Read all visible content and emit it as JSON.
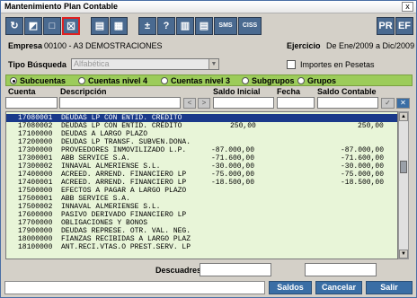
{
  "window": {
    "title": "Mantenimiento Plan Contable",
    "close": "x"
  },
  "toolbar": {
    "sms": "SMS",
    "ciss": "CISS",
    "pr": "PR",
    "ef": "EF"
  },
  "header": {
    "empresa_label": "Empresa",
    "empresa_value": "00100 - A3 DEMOSTRACIONES",
    "ejercicio_label": "Ejercicio",
    "ejercicio_value": "De Ene/2009 a Dic/2009",
    "tipo_label": "Tipo Búsqueda",
    "tipo_value": "Alfabética",
    "importes_label": "Importes en Pesetas",
    "importes_checked": false
  },
  "radios": [
    {
      "label": "Subcuentas",
      "on": true
    },
    {
      "label": "Cuentas nivel 4",
      "on": false
    },
    {
      "label": "Cuentas nivel 3",
      "on": false
    },
    {
      "label": "Subgrupos",
      "on": false
    },
    {
      "label": "Grupos",
      "on": false
    }
  ],
  "columns": {
    "cuenta": "Cuenta",
    "descripcion": "Descripción",
    "saldo_inicial": "Saldo Inicial",
    "fecha": "Fecha",
    "saldo_contable": "Saldo Contable"
  },
  "rows": [
    {
      "cuenta": "17080001",
      "desc": "DEUDAS LP CON ENTID. CRÉDITO",
      "si": "",
      "sc": "",
      "sel": true
    },
    {
      "cuenta": "17080002",
      "desc": "DEUDAS LP CON ENTID. CRÉDITO",
      "si": "250,00",
      "sc": "250,00"
    },
    {
      "cuenta": "17100000",
      "desc": "DEUDAS A LARGO PLAZO",
      "si": "",
      "sc": ""
    },
    {
      "cuenta": "17200000",
      "desc": "DEUDAS LP TRANSF. SUBVEN.DONA.",
      "si": "",
      "sc": ""
    },
    {
      "cuenta": "17300000",
      "desc": "PROVEEDORES INMOVILIZADO L.P.",
      "si": "-87.000,00",
      "sc": "-87.000,00"
    },
    {
      "cuenta": "17300001",
      "desc": "ABB SERVICE S.A.",
      "si": "-71.600,00",
      "sc": "-71.600,00"
    },
    {
      "cuenta": "17300002",
      "desc": "INNAVAL ALMERIENSE S.L.",
      "si": "-30.000,00",
      "sc": "-30.000,00"
    },
    {
      "cuenta": "17400000",
      "desc": "ACREED. ARREND. FINANCIERO LP",
      "si": "-75.000,00",
      "sc": "-75.000,00"
    },
    {
      "cuenta": "17400001",
      "desc": "ACREED. ARREND. FINANCIERO LP",
      "si": "-18.500,00",
      "sc": "-18.500,00"
    },
    {
      "cuenta": "17500000",
      "desc": "EFECTOS A PAGAR A LARGO PLAZO",
      "si": "",
      "sc": ""
    },
    {
      "cuenta": "17500001",
      "desc": "ABB SERVICE S.A.",
      "si": "",
      "sc": ""
    },
    {
      "cuenta": "17500002",
      "desc": "INNAVAL ALMERIENSE S.L.",
      "si": "",
      "sc": ""
    },
    {
      "cuenta": "17600000",
      "desc": "PASIVO DERIVADO FINANCIERO LP",
      "si": "",
      "sc": ""
    },
    {
      "cuenta": "17700000",
      "desc": "OBLIGACIONES Y BONOS",
      "si": "",
      "sc": ""
    },
    {
      "cuenta": "17900000",
      "desc": "DEUDAS REPRESE. OTR. VAL. NEG.",
      "si": "",
      "sc": ""
    },
    {
      "cuenta": "18000000",
      "desc": "FIANZAS RECIBIDAS A LARGO PLAZ",
      "si": "",
      "sc": ""
    },
    {
      "cuenta": "18100000",
      "desc": "ANT.RECI.VTAS.O PREST.SERV. LP",
      "si": "",
      "sc": ""
    }
  ],
  "footer": {
    "descuadres_label": "Descuadres"
  },
  "buttons": {
    "saldos": "Saldos",
    "cancelar": "Cancelar",
    "salir": "Salir"
  },
  "colors": {
    "grid_bg": "#e8f5d8",
    "radio_bar": "#9ccc5a",
    "selected": "#1a3a8a",
    "button": "#3a6ea5"
  }
}
